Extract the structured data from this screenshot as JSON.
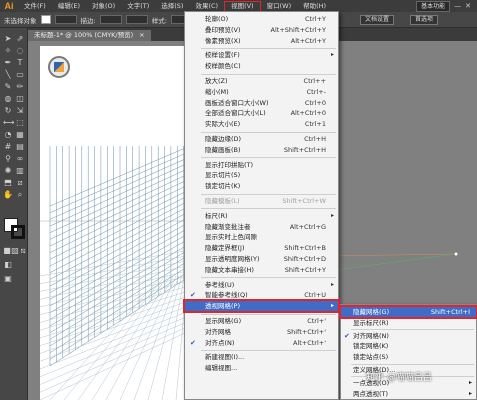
{
  "menubar": {
    "logo": "Ai",
    "items": [
      "文件(F)",
      "编辑(E)",
      "对象(O)",
      "文字(T)",
      "选择(S)",
      "效果(C)",
      "视图(V)",
      "窗口(W)",
      "帮助(H)"
    ],
    "active_index": 6,
    "workspace_label": "基本功能"
  },
  "controlbar": {
    "selection_label": "未选择对象",
    "stroke_label": "描边:",
    "style_label": "样式:",
    "doc_settings": "文档设置",
    "preferences": "首选项"
  },
  "document_tab": {
    "title": "未标题-1* @ 100% (CMYK/预览)",
    "close": "×"
  },
  "view_menu": {
    "items": [
      {
        "label": "轮廓(O)",
        "shortcut": "Ctrl+Y"
      },
      {
        "label": "叠印预览(V)",
        "shortcut": "Alt+Shift+Ctrl+Y"
      },
      {
        "label": "像素预览(X)",
        "shortcut": "Alt+Ctrl+Y"
      },
      {
        "label": "校样设置(F)",
        "shortcut": "",
        "arrow": true
      },
      {
        "label": "校样颜色(C)",
        "shortcut": ""
      },
      {
        "label": "放大(Z)",
        "shortcut": "Ctrl++"
      },
      {
        "label": "缩小(M)",
        "shortcut": "Ctrl+-"
      },
      {
        "label": "画板适合窗口大小(W)",
        "shortcut": "Ctrl+0"
      },
      {
        "label": "全部适合窗口大小(L)",
        "shortcut": "Alt+Ctrl+0"
      },
      {
        "label": "实际大小(E)",
        "shortcut": "Ctrl+1"
      },
      {
        "label": "隐藏边缘(D)",
        "shortcut": "Ctrl+H"
      },
      {
        "label": "隐藏画板(B)",
        "shortcut": "Shift+Ctrl+H"
      },
      {
        "label": "显示打印拼贴(T)",
        "shortcut": ""
      },
      {
        "label": "显示切片(S)",
        "shortcut": ""
      },
      {
        "label": "锁定切片(K)",
        "shortcut": ""
      },
      {
        "label": "隐藏模板(L)",
        "shortcut": "Shift+Ctrl+W",
        "disabled": true
      },
      {
        "label": "标尺(R)",
        "shortcut": "",
        "arrow": true
      },
      {
        "label": "隐藏渐变批注者",
        "shortcut": "Alt+Ctrl+G"
      },
      {
        "label": "显示实时上色间隙",
        "shortcut": ""
      },
      {
        "label": "隐藏定界框(J)",
        "shortcut": "Shift+Ctrl+B"
      },
      {
        "label": "显示透明度网格(Y)",
        "shortcut": "Shift+Ctrl+D"
      },
      {
        "label": "隐藏文本串接(H)",
        "shortcut": "Shift+Ctrl+Y"
      },
      {
        "label": "参考线(U)",
        "shortcut": "",
        "arrow": true
      },
      {
        "label": "智能参考线(Q)",
        "shortcut": "Ctrl+U",
        "checked": true
      },
      {
        "label": "透视网格(P)",
        "shortcut": "",
        "arrow": true,
        "highlighted": true
      },
      {
        "label": "显示网格(G)",
        "shortcut": "Ctrl+'"
      },
      {
        "label": "对齐网格",
        "shortcut": "Shift+Ctrl+'"
      },
      {
        "label": "对齐点(N)",
        "shortcut": "Alt+Ctrl+'",
        "checked": true
      },
      {
        "label": "新建视图(I)...",
        "shortcut": ""
      },
      {
        "label": "编辑视图...",
        "shortcut": ""
      }
    ]
  },
  "perspective_submenu": {
    "items": [
      {
        "label": "隐藏网格(G)",
        "shortcut": "Shift+Ctrl+I",
        "highlighted": true
      },
      {
        "label": "显示标尺(R)",
        "shortcut": ""
      },
      {
        "label": "对齐网格(N)",
        "shortcut": "",
        "checked": true
      },
      {
        "label": "锁定网格(K)",
        "shortcut": ""
      },
      {
        "label": "锁定站点(S)",
        "shortcut": ""
      },
      {
        "label": "定义网格(D)...",
        "shortcut": ""
      },
      {
        "label": "一点透视(O)",
        "shortcut": "",
        "arrow": true
      },
      {
        "label": "两点透视(T)",
        "shortcut": "",
        "arrow": true
      }
    ]
  },
  "watermark": "知乎 @喵喵吕吕",
  "colors": {
    "menubar": "#3c3c3c",
    "menu_bg": "#f3f3f3",
    "highlight": "#3f6cc7",
    "annotation_red": "#e0262d",
    "logo": "#f29d1c"
  }
}
